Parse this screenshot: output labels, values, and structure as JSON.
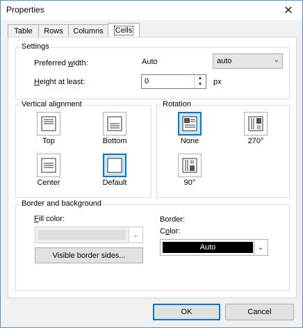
{
  "window": {
    "title": "Properties",
    "close_glyph": "✕"
  },
  "tabs": [
    {
      "label": "Table",
      "active": false
    },
    {
      "label": "Rows",
      "active": false
    },
    {
      "label": "Columns",
      "active": false
    },
    {
      "label": "Cells",
      "active": true
    }
  ],
  "settings": {
    "title": "Settings",
    "preferred_width_label": "Preferred width:",
    "preferred_width_value": "Auto",
    "width_unit_select": "auto",
    "height_label": "Height at least:",
    "height_value": "0",
    "height_unit": "px"
  },
  "vertical_alignment": {
    "title": "Vertical alignment",
    "options": [
      "Top",
      "Bottom",
      "Center",
      "Default"
    ],
    "selected": "Default"
  },
  "rotation": {
    "title": "Rotation",
    "options": [
      "None",
      "270°",
      "90°"
    ],
    "selected": "None"
  },
  "border_background": {
    "title": "Border and background",
    "fill_color_label": "Fill color:",
    "visible_border_sides": "Visible border sides...",
    "border_label": "Border:",
    "color_label": "Color:",
    "color_value": "Auto"
  },
  "buttons": {
    "ok": "OK",
    "cancel": "Cancel"
  },
  "colors": {
    "accent": "#0078d7",
    "selected_bg": "#cce4f7",
    "border_color_swatch": "#000000"
  }
}
